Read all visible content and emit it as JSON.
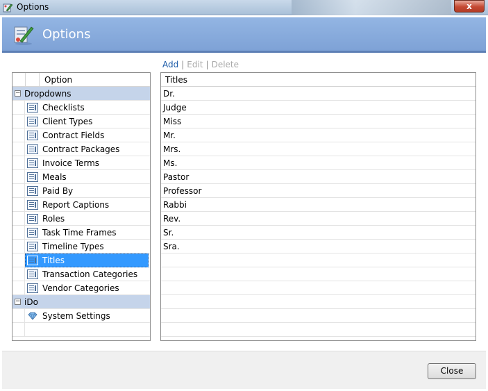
{
  "window": {
    "title": "Options",
    "close_glyph": "x"
  },
  "header": {
    "title": "Options"
  },
  "actions": {
    "add": "Add",
    "edit": "Edit",
    "delete": "Delete"
  },
  "left_grid": {
    "column_header": "Option",
    "groups": [
      {
        "label": "Dropdowns",
        "items": [
          "Checklists",
          "Client Types",
          "Contract Fields",
          "Contract Packages",
          "Invoice Terms",
          "Meals",
          "Paid By",
          "Report Captions",
          "Roles",
          "Task Time Frames",
          "Timeline Types",
          "Titles",
          "Transaction Categories",
          "Vendor Categories"
        ]
      },
      {
        "label": "iDo",
        "items": [
          "System Settings"
        ]
      }
    ],
    "selected": "Titles"
  },
  "right_grid": {
    "column_header": "Titles",
    "rows": [
      "Dr.",
      "Judge",
      "Miss",
      "Mr.",
      "Mrs.",
      "Ms.",
      "Pastor",
      "Professor",
      "Rabbi",
      "Rev.",
      "Sr.",
      "Sra."
    ]
  },
  "footer": {
    "close_label": "Close"
  },
  "colors": {
    "header_bg": "#7ea2d6",
    "selection": "#3399ff",
    "group_bg": "#c5d4ea",
    "link": "#1a5aa8"
  }
}
